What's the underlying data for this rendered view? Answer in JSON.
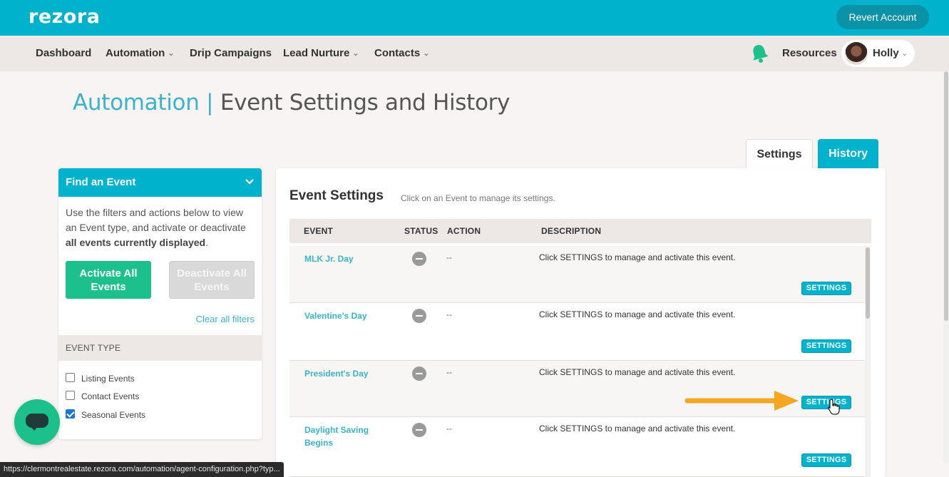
{
  "header": {
    "logo": "rezora",
    "revert_label": "Revert Account"
  },
  "nav": {
    "items": [
      {
        "label": "Dashboard",
        "has_dropdown": false
      },
      {
        "label": "Automation",
        "has_dropdown": true
      },
      {
        "label": "Drip Campaigns",
        "has_dropdown": false
      },
      {
        "label": "Lead Nurture",
        "has_dropdown": true
      },
      {
        "label": "Contacts",
        "has_dropdown": true
      }
    ],
    "resources_label": "Resources",
    "user_name": "Holly",
    "bell_icon": "bell-icon"
  },
  "page": {
    "crumb": "Automation",
    "separator": " | ",
    "title": "Event Settings and History"
  },
  "tabs": {
    "settings": "Settings",
    "history": "History"
  },
  "sidebar": {
    "title": "Find an Event",
    "desc_pre": "Use the filters and actions below to view an Event type, and activate or deactivate ",
    "desc_bold": "all events currently displayed",
    "desc_post": ".",
    "activate_label": "Activate All Events",
    "deactivate_label": "Deactivate All Events",
    "clear_label": "Clear all filters",
    "event_type_heading": "EVENT TYPE",
    "filters": [
      {
        "label": "Listing Events",
        "checked": false
      },
      {
        "label": "Contact Events",
        "checked": false
      },
      {
        "label": "Seasonal Events",
        "checked": true
      }
    ]
  },
  "main": {
    "title": "Event Settings",
    "subtitle": "Click on an Event to manage its settings.",
    "columns": {
      "event": "EVENT",
      "status": "STATUS",
      "action": "ACTION",
      "description": "DESCRIPTION"
    },
    "rows": [
      {
        "name": "MLK Jr. Day",
        "action": "--",
        "description": "Click SETTINGS to manage and activate this event.",
        "button": "SETTINGS"
      },
      {
        "name": "Valentine's Day",
        "action": "--",
        "description": "Click SETTINGS to manage and activate this event.",
        "button": "SETTINGS"
      },
      {
        "name": "President's Day",
        "action": "--",
        "description": "Click SETTINGS to manage and activate this event.",
        "button": "SETTINGS"
      },
      {
        "name": "Daylight Saving Begins",
        "action": "--",
        "description": "Click SETTINGS to manage and activate this event.",
        "button": "SETTINGS"
      }
    ]
  },
  "statusbar": {
    "url": "https://clermontrealestate.rezora.com/automation/agent-configuration.php?typ..."
  },
  "colors": {
    "brand": "#00b2cb",
    "accent_green": "#1cc08a",
    "annotation_arrow": "#f5a623"
  }
}
